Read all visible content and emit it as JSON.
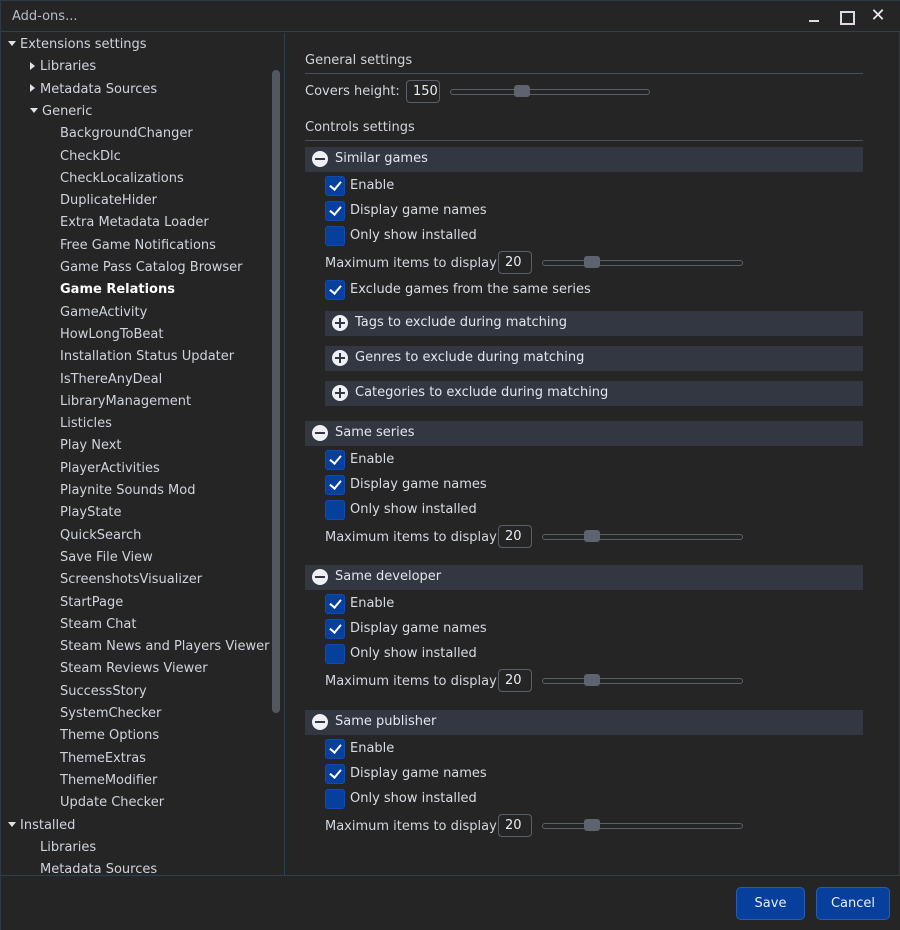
{
  "window": {
    "title": "Add-ons...",
    "controls": [
      "minimize",
      "maximize",
      "close"
    ],
    "close_glyph": "✕"
  },
  "sidebar": {
    "tree": [
      {
        "label": "Extensions settings",
        "level": 0,
        "state": "expanded"
      },
      {
        "label": "Libraries",
        "level": 1,
        "state": "collapsed"
      },
      {
        "label": "Metadata Sources",
        "level": 1,
        "state": "collapsed"
      },
      {
        "label": "Generic",
        "level": 1,
        "state": "expanded"
      },
      {
        "label": "BackgroundChanger",
        "level": 2
      },
      {
        "label": "CheckDlc",
        "level": 2
      },
      {
        "label": "CheckLocalizations",
        "level": 2
      },
      {
        "label": "DuplicateHider",
        "level": 2
      },
      {
        "label": "Extra Metadata Loader",
        "level": 2
      },
      {
        "label": "Free Game Notifications",
        "level": 2
      },
      {
        "label": "Game Pass Catalog Browser",
        "level": 2
      },
      {
        "label": "Game Relations",
        "level": 2,
        "selected": true
      },
      {
        "label": "GameActivity",
        "level": 2
      },
      {
        "label": "HowLongToBeat",
        "level": 2
      },
      {
        "label": "Installation Status Updater",
        "level": 2
      },
      {
        "label": "IsThereAnyDeal",
        "level": 2
      },
      {
        "label": "LibraryManagement",
        "level": 2
      },
      {
        "label": "Listicles",
        "level": 2
      },
      {
        "label": "Play Next",
        "level": 2
      },
      {
        "label": "PlayerActivities",
        "level": 2
      },
      {
        "label": "Playnite Sounds Mod",
        "level": 2
      },
      {
        "label": "PlayState",
        "level": 2
      },
      {
        "label": "QuickSearch",
        "level": 2
      },
      {
        "label": "Save File View",
        "level": 2
      },
      {
        "label": "ScreenshotsVisualizer",
        "level": 2
      },
      {
        "label": "StartPage",
        "level": 2
      },
      {
        "label": "Steam Chat",
        "level": 2
      },
      {
        "label": "Steam News and Players Viewer",
        "level": 2
      },
      {
        "label": "Steam Reviews Viewer",
        "level": 2
      },
      {
        "label": "SuccessStory",
        "level": 2
      },
      {
        "label": "SystemChecker",
        "level": 2
      },
      {
        "label": "Theme Options",
        "level": 2
      },
      {
        "label": "ThemeExtras",
        "level": 2
      },
      {
        "label": "ThemeModifier",
        "level": 2
      },
      {
        "label": "Update Checker",
        "level": 2
      },
      {
        "label": "Installed",
        "level": 0,
        "state": "expanded"
      },
      {
        "label": "Libraries",
        "level": 1
      },
      {
        "label": "Metadata Sources",
        "level": 1
      }
    ]
  },
  "general": {
    "title": "General settings",
    "covers_height_label": "Covers height:",
    "covers_height_value": "150",
    "covers_height_fraction": 0.34
  },
  "controls": {
    "title": "Controls settings",
    "sections": [
      {
        "title": "Similar games",
        "enable_label": "Enable",
        "enable": true,
        "names_label": "Display game names",
        "names": true,
        "installed_label": "Only show installed",
        "installed": false,
        "max_label": "Maximum items to display",
        "max_value": "20",
        "max_fraction": 0.22,
        "exclude_label": "Exclude games from the same series",
        "exclude": true,
        "subgroups": [
          "Tags to exclude during matching",
          "Genres to exclude during matching",
          "Categories to exclude during matching"
        ]
      },
      {
        "title": "Same series",
        "enable_label": "Enable",
        "enable": true,
        "names_label": "Display game names",
        "names": true,
        "installed_label": "Only show installed",
        "installed": false,
        "max_label": "Maximum items to display",
        "max_value": "20",
        "max_fraction": 0.22
      },
      {
        "title": "Same developer",
        "enable_label": "Enable",
        "enable": true,
        "names_label": "Display game names",
        "names": true,
        "installed_label": "Only show installed",
        "installed": false,
        "max_label": "Maximum items to display",
        "max_value": "20",
        "max_fraction": 0.22
      },
      {
        "title": "Same publisher",
        "enable_label": "Enable",
        "enable": true,
        "names_label": "Display game names",
        "names": true,
        "installed_label": "Only show installed",
        "installed": false,
        "max_label": "Maximum items to display",
        "max_value": "20",
        "max_fraction": 0.22
      }
    ]
  },
  "footer": {
    "save_label": "Save",
    "cancel_label": "Cancel"
  },
  "colors": {
    "accent": "#073f9c",
    "background": "#252526",
    "header_band": "#323741"
  }
}
